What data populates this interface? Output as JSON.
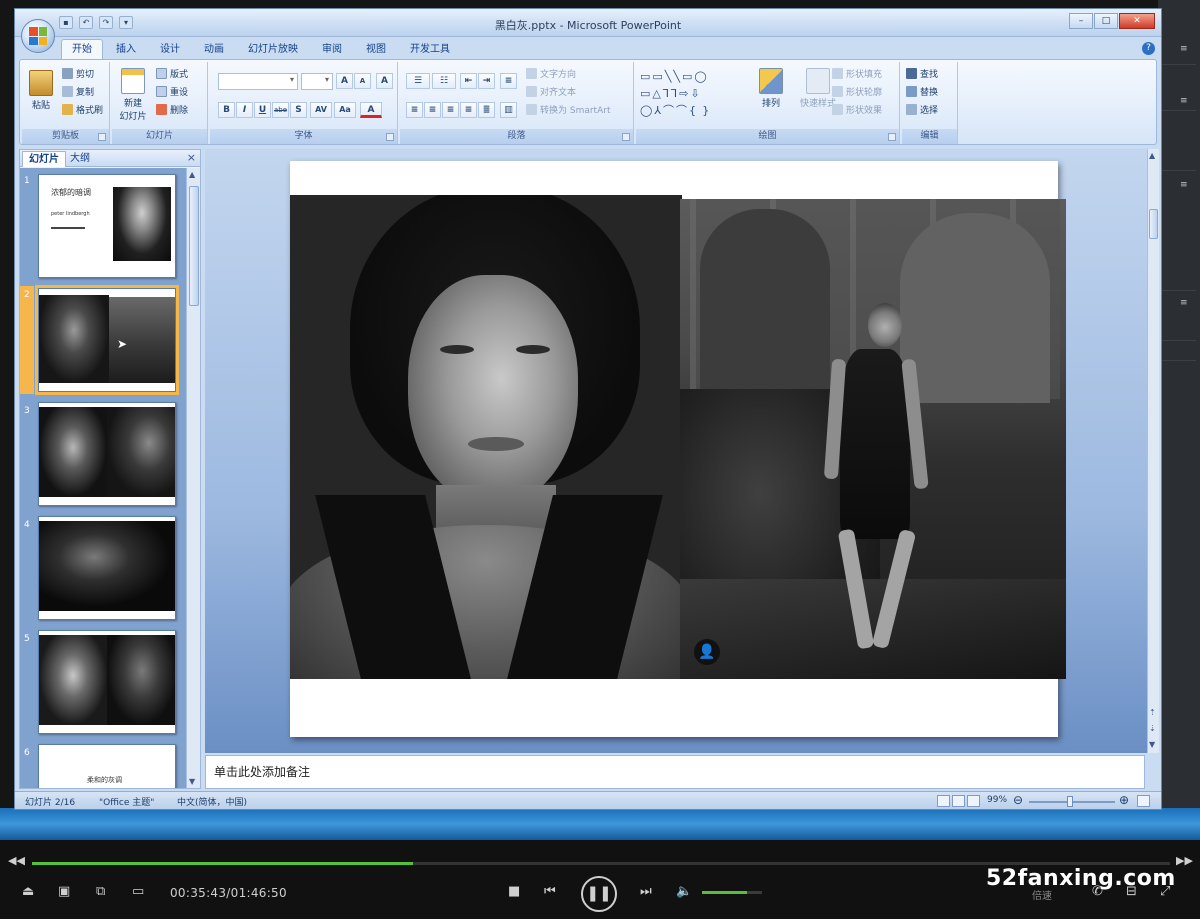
{
  "window": {
    "title": "黑白灰.pptx - Microsoft PowerPoint",
    "controls": {
      "minimize": "–",
      "maximize": "□",
      "close": "✕"
    }
  },
  "ribbon": {
    "tabs": [
      "开始",
      "插入",
      "设计",
      "动画",
      "幻灯片放映",
      "审阅",
      "视图",
      "开发工具"
    ],
    "active_tab": "开始",
    "clipboard": {
      "title": "剪贴板",
      "paste": "粘贴",
      "cut": "剪切",
      "copy": "复制",
      "format_painter": "格式刷"
    },
    "slides": {
      "title": "幻灯片",
      "new_slide_line1": "新建",
      "new_slide_line2": "幻灯片",
      "layout": "版式",
      "reset": "重设",
      "delete": "删除"
    },
    "font": {
      "title": "字体",
      "grow": "A",
      "shrink": "A",
      "clear": "A",
      "bold": "B",
      "italic": "I",
      "underline": "U",
      "strike": "abe",
      "shadow": "S",
      "spacing": "AV",
      "case": "Aa",
      "color": "A"
    },
    "paragraph": {
      "title": "段落",
      "text_direction": "文字方向",
      "align_text": "对齐文本",
      "smartart": "转换为 SmartArt"
    },
    "drawing": {
      "title": "绘图",
      "arrange": "排列",
      "quick_styles": "快速样式",
      "shape_fill": "形状填充",
      "shape_outline": "形状轮廓",
      "shape_effects": "形状效果"
    },
    "editing": {
      "title": "编辑",
      "find": "查找",
      "replace": "替换",
      "select": "选择"
    }
  },
  "slide_panel": {
    "tabs": [
      "幻灯片",
      "大纲"
    ],
    "active_tab": "幻灯片",
    "close": "×",
    "thumbnails": [
      {
        "num": "1",
        "title": "浓郁的暗调",
        "subtitle": "peter lindbergh"
      },
      {
        "num": "2"
      },
      {
        "num": "3"
      },
      {
        "num": "4"
      },
      {
        "num": "5"
      },
      {
        "num": "6",
        "title": "柔和的灰调"
      }
    ],
    "selected": "2"
  },
  "notes": {
    "placeholder": "单击此处添加备注"
  },
  "status_bar": {
    "slide": "幻灯片 2/16",
    "theme": "\"Office 主题\"",
    "language": "中文(简体，中国)",
    "zoom": "99%"
  },
  "player": {
    "time": "00:35:43/01:46:50",
    "progress": 0.335,
    "volume": 0.75,
    "watermark": "52fanxing.com",
    "speed_label": "倍速"
  },
  "colors": {
    "ribbon_text": "#15428b",
    "player_accent": "#56c03a",
    "selection": "#f5b64c"
  }
}
